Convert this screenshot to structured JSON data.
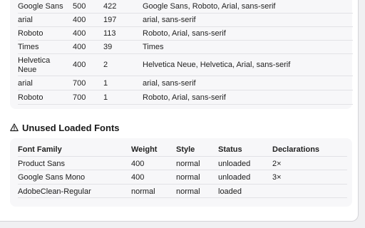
{
  "top_table": {
    "rows": [
      {
        "family": "Google Sans",
        "weight": "500",
        "count": "422",
        "stack": "Google Sans, Roboto, Arial, sans-serif"
      },
      {
        "family": "arial",
        "weight": "400",
        "count": "197",
        "stack": "arial, sans-serif"
      },
      {
        "family": "Roboto",
        "weight": "400",
        "count": "113",
        "stack": "Roboto, Arial, sans-serif"
      },
      {
        "family": "Times",
        "weight": "400",
        "count": "39",
        "stack": "Times"
      },
      {
        "family": "Helvetica Neue",
        "weight": "400",
        "count": "2",
        "stack": "Helvetica Neue, Helvetica, Arial, sans-serif"
      },
      {
        "family": "arial",
        "weight": "700",
        "count": "1",
        "stack": "arial, sans-serif"
      },
      {
        "family": "Roboto",
        "weight": "700",
        "count": "1",
        "stack": "Roboto, Arial, sans-serif"
      }
    ]
  },
  "unused_section": {
    "title": "Unused Loaded Fonts",
    "icon": "warning-icon",
    "headers": {
      "family": "Font Family",
      "weight": "Weight",
      "style": "Style",
      "status": "Status",
      "declarations": "Declarations"
    },
    "rows": [
      {
        "family": "Product Sans",
        "weight": "400",
        "style": "normal",
        "status": "unloaded",
        "declarations": "2×"
      },
      {
        "family": "Google Sans Mono",
        "weight": "400",
        "style": "normal",
        "status": "unloaded",
        "declarations": "3×"
      },
      {
        "family": "AdobeClean-Regular",
        "weight": "normal",
        "style": "normal",
        "status": "loaded",
        "declarations": ""
      }
    ]
  }
}
